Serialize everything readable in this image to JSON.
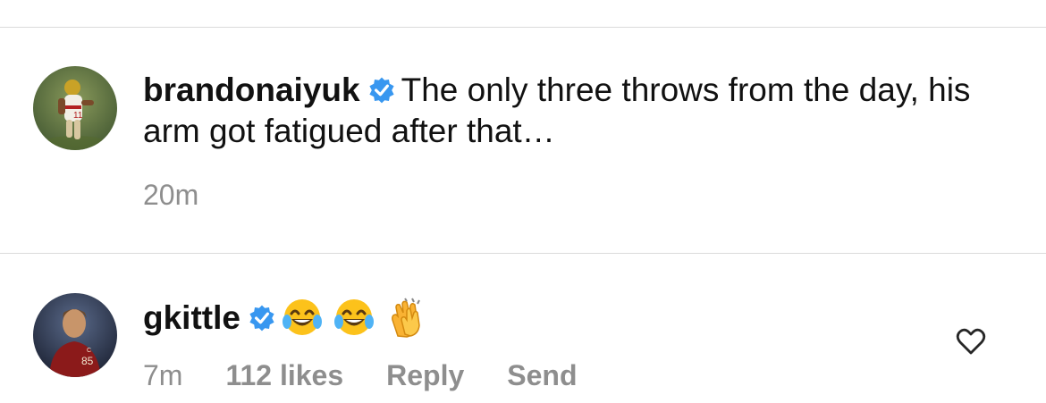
{
  "comments": [
    {
      "username": "brandonaiyuk",
      "verified_icon": "verified-badge-icon",
      "text": "The only three throws from the day, his arm got fatigued after that…",
      "time": "20m",
      "avatar_icon": "profile-photo-football-player"
    },
    {
      "username": "gkittle",
      "verified_icon": "verified-badge-icon",
      "emojis": [
        "face-with-tears-of-joy",
        "face-with-tears-of-joy",
        "clapping-hands"
      ],
      "time": "7m",
      "likes": "112 likes",
      "reply_label": "Reply",
      "send_label": "Send",
      "like_icon": "heart-outline-icon",
      "avatar_icon": "profile-photo-football-player"
    }
  ],
  "colors": {
    "verified_blue": "#3897f0",
    "meta_gray": "#8e8e8e",
    "divider": "#dbdbdb"
  }
}
